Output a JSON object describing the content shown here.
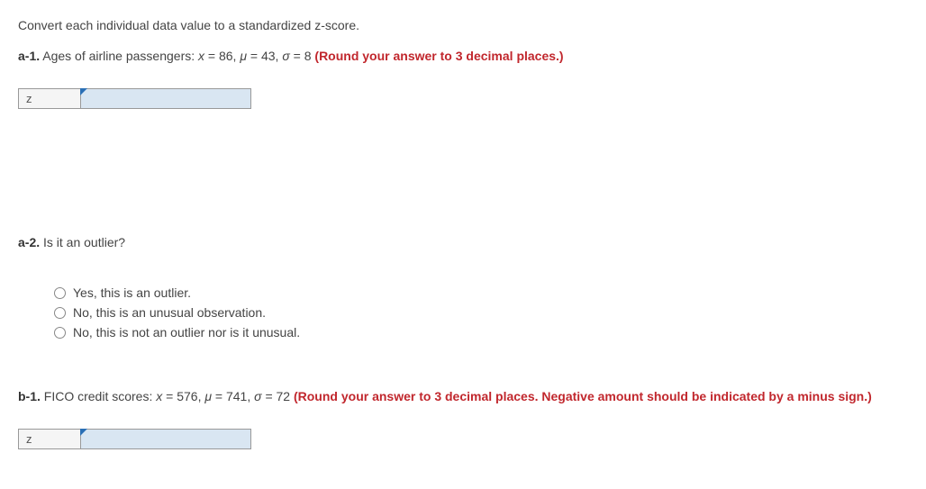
{
  "instruction": "Convert each individual data value to a standardized z-score.",
  "a1": {
    "label": "a-1.",
    "text_before": " Ages of airline passengers: ",
    "var_x": "x",
    "eq_x": " = 86, ",
    "var_mu": "μ",
    "eq_mu": " = 43, ",
    "var_sigma": "σ",
    "eq_sigma": " = 8 ",
    "hint": "(Round your answer to 3 decimal places.)"
  },
  "input_label": "z",
  "a2": {
    "label": "a-2.",
    "text": " Is it an outlier?"
  },
  "options": [
    "Yes, this is an outlier.",
    "No, this is an unusual observation.",
    "No, this is not an outlier nor is it unusual."
  ],
  "b1": {
    "label": "b-1.",
    "text_before": " FICO credit scores: ",
    "var_x": "x",
    "eq_x": " = 576, ",
    "var_mu": "μ",
    "eq_mu": " = 741, ",
    "var_sigma": "σ",
    "eq_sigma": " = 72 ",
    "hint": "(Round your answer to 3 decimal places. Negative amount should be indicated by a minus sign.)"
  }
}
